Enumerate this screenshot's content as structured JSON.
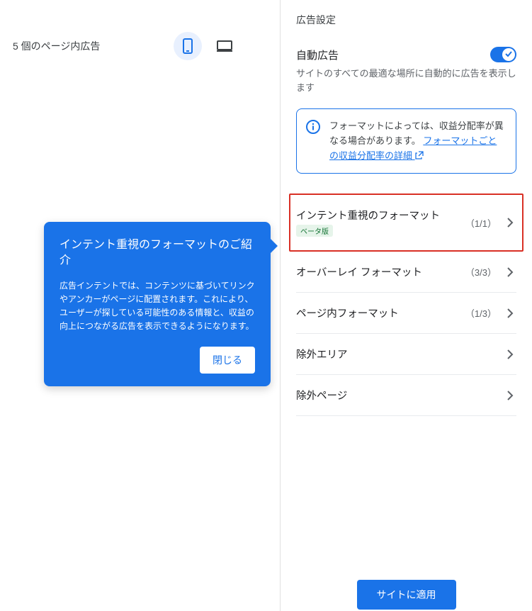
{
  "left": {
    "page_ads_label": "5 個のページ内広告"
  },
  "tooltip": {
    "title": "インテント重視のフォーマットのご紹介",
    "body": "広告インテントでは、コンテンツに基づいてリンクやアンカーがページに配置されます。これにより、ユーザーが探している可能性のある情報と、収益の向上につながる広告を表示できるようになります。",
    "close": "閉じる"
  },
  "panel": {
    "header": "広告設定",
    "auto_ads_label": "自動広告",
    "auto_ads_desc": "サイトのすべての最適な場所に自動的に広告を表示します",
    "info_text": "フォーマットによっては、収益分配率が異なる場合があります。",
    "info_link": "フォーマットごとの収益分配率の詳細",
    "formats": [
      {
        "label": "インテント重視のフォーマット",
        "count": "（1/1）",
        "beta": "ベータ版",
        "highlighted": true
      },
      {
        "label": "オーバーレイ フォーマット",
        "count": "（3/3）",
        "beta": null,
        "highlighted": false
      },
      {
        "label": "ページ内フォーマット",
        "count": "（1/3）",
        "beta": null,
        "highlighted": false
      },
      {
        "label": "除外エリア",
        "count": null,
        "beta": null,
        "highlighted": false
      },
      {
        "label": "除外ページ",
        "count": null,
        "beta": null,
        "highlighted": false
      }
    ],
    "apply": "サイトに適用"
  }
}
